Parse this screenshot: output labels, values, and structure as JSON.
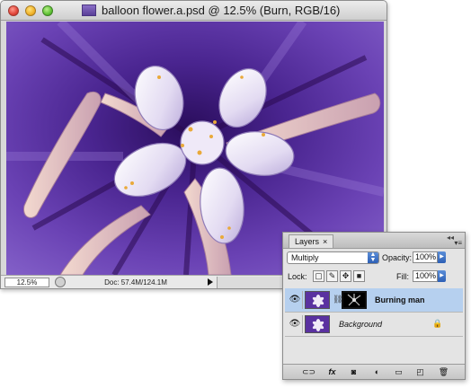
{
  "document": {
    "title": "balloon flower.a.psd @ 12.5% (Burn, RGB/16)",
    "zoom": "12.5%",
    "doc_size": "Doc: 57.4M/124.1M"
  },
  "layers_panel": {
    "tab_label": "Layers",
    "tab_close": "×",
    "blend_mode": "Multiply",
    "opacity_label": "Opacity:",
    "opacity_value": "100%",
    "lock_label": "Lock:",
    "fill_label": "Fill:",
    "fill_value": "100%",
    "layers": [
      {
        "name": "Burning man",
        "visible": true,
        "selected": true,
        "has_mask": true
      },
      {
        "name": "Background",
        "visible": true,
        "selected": false,
        "locked": true
      }
    ]
  },
  "colors": {
    "flower_purple": "#6a3fae",
    "selection_blue": "#b6d0ef",
    "accent_blue": "#2c5fb5"
  }
}
